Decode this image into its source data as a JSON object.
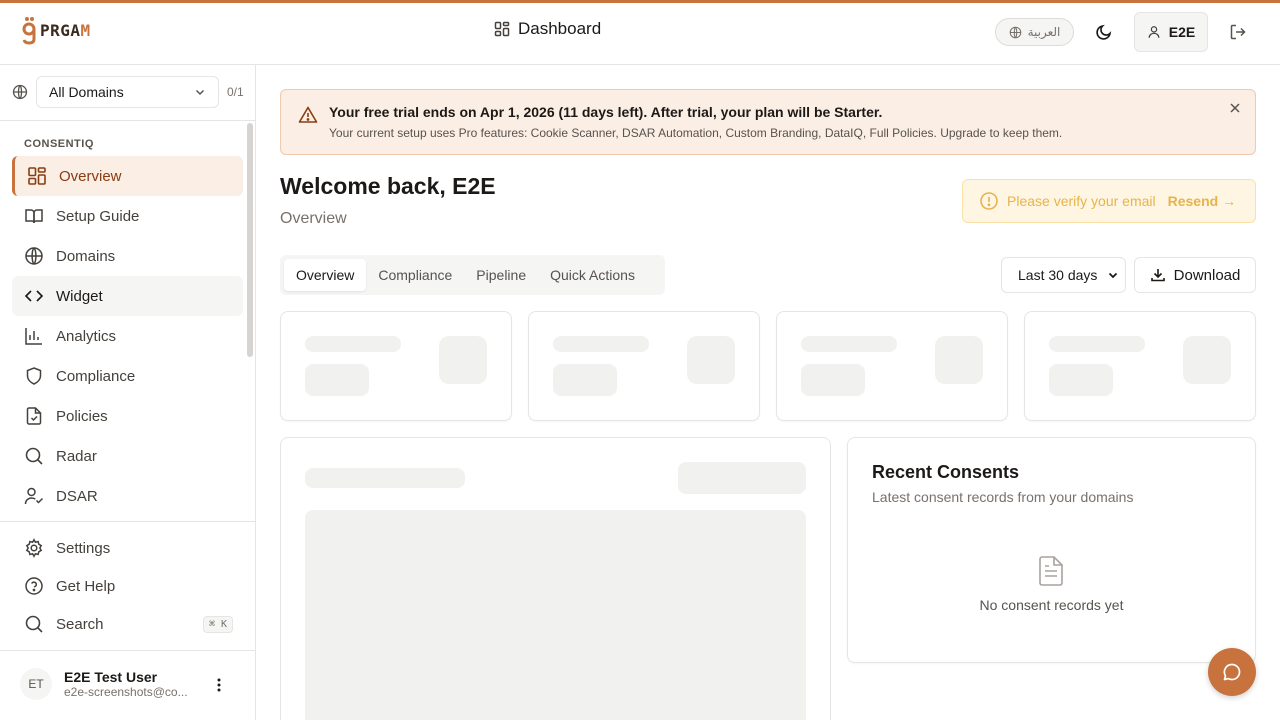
{
  "app": {
    "logo_text_a": "PRGA",
    "logo_text_b": "M",
    "page_title": "Dashboard",
    "language_label": "العربية",
    "user_button_label": "E2E"
  },
  "sidebar": {
    "domain_select": "All Domains",
    "domain_count": "0/1",
    "section_label": "CONSENTIQ",
    "items": [
      {
        "label": "Overview",
        "icon": "layout-grid-icon"
      },
      {
        "label": "Setup Guide",
        "icon": "book-open-icon"
      },
      {
        "label": "Domains",
        "icon": "globe-icon"
      },
      {
        "label": "Widget",
        "icon": "code-icon"
      },
      {
        "label": "Analytics",
        "icon": "bar-chart-icon"
      },
      {
        "label": "Compliance",
        "icon": "shield-icon"
      },
      {
        "label": "Policies",
        "icon": "file-check-icon"
      },
      {
        "label": "Radar",
        "icon": "search-icon"
      },
      {
        "label": "DSAR",
        "icon": "user-check-icon"
      }
    ],
    "bottom_items": [
      {
        "label": "Settings",
        "icon": "gear-icon"
      },
      {
        "label": "Get Help",
        "icon": "help-circle-icon"
      },
      {
        "label": "Search",
        "icon": "search-icon",
        "shortcut": "⌘ K"
      }
    ],
    "user": {
      "initials": "ET",
      "name": "E2E Test User",
      "email": "e2e-screenshots@co..."
    }
  },
  "banner": {
    "title": "Your free trial ends on Apr 1, 2026 (11 days left). After trial, your plan will be Starter.",
    "description": "Your current setup uses Pro features: Cookie Scanner, DSAR Automation, Custom Branding, DataIQ, Full Policies. Upgrade to keep them."
  },
  "main": {
    "welcome": "Welcome back, E2E",
    "subtitle": "Overview",
    "verify_text": "Please verify your email",
    "verify_action": "Resend →",
    "tabs": [
      "Overview",
      "Compliance",
      "Pipeline",
      "Quick Actions"
    ],
    "range_select": "Last 30 days",
    "download_label": "Download"
  },
  "recent_consents": {
    "title": "Recent Consents",
    "description": "Latest consent records from your domains",
    "empty": "No consent records yet"
  },
  "colors": {
    "accent": "#c8733d",
    "banner_bg": "#fbeee4",
    "verify_text": "#e8b34a"
  }
}
